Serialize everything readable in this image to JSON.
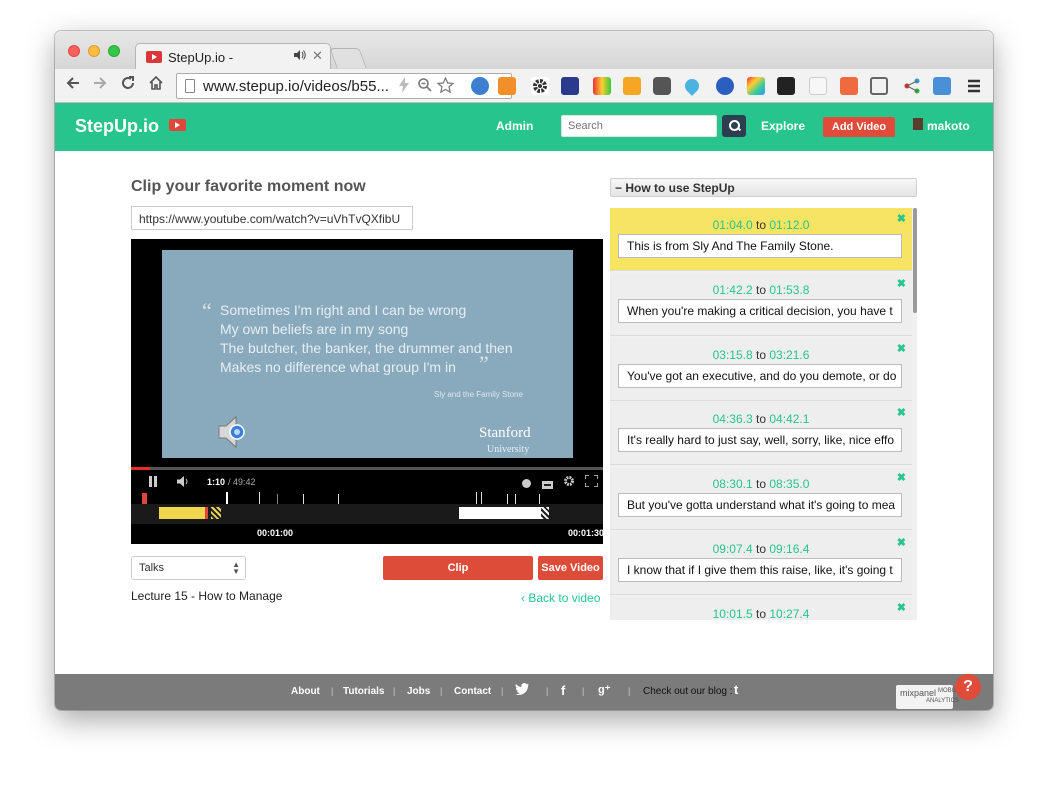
{
  "browser": {
    "tab_title": "StepUp.io -",
    "tab_audio_icon": "speaker-icon",
    "tab_close": "✕",
    "url": "www.stepup.io/videos/b55...",
    "nav": [
      "back-icon",
      "forward-icon",
      "reload-icon",
      "home-icon"
    ]
  },
  "header": {
    "logo": "StepUp.io",
    "admin": "Admin",
    "search_placeholder": "Search",
    "explore": "Explore",
    "add_video": "Add Video",
    "username": "makoto",
    "brand_color": "#27c58d",
    "accent_color": "#dd4b39"
  },
  "main": {
    "title": "Clip your favorite moment now",
    "video_url": "https://www.youtube.com/watch?v=uVhTvQXfibU",
    "slide": {
      "quote_open": "“",
      "quote_close": "”",
      "lines": [
        "Sometimes I'm right and I can be wrong",
        "My own beliefs are in my song",
        "The butcher, the banker, the drummer and then",
        "Makes no difference what group I'm in"
      ],
      "attribution": "Sly and the Family Stone",
      "logo_line1": "Stanford",
      "logo_line2": "University"
    },
    "player": {
      "current_time": "1:10",
      "duration": "/ 49:42",
      "progress_fraction": 0.0235,
      "timeline_labels": [
        "00:01:00",
        "00:01:30"
      ]
    },
    "category": "Talks",
    "clip_button": "Clip",
    "save_button": "Save Video",
    "lecture": "Lecture 15 - How to Manage",
    "back_link": "Back to video"
  },
  "sidebar": {
    "howto": "How to use StepUp",
    "howto_toggle": "−",
    "connector": "to",
    "clips": [
      {
        "start": "01:04.0",
        "end": "01:12.0",
        "note": "This is from Sly And The Family Stone.",
        "active": true
      },
      {
        "start": "01:42.2",
        "end": "01:53.8",
        "note": "When you're making a critical decision, you have t"
      },
      {
        "start": "03:15.8",
        "end": "03:21.6",
        "note": "You've got an executive, and do you demote, or do"
      },
      {
        "start": "04:36.3",
        "end": "04:42.1",
        "note": "It's really hard to just say, well, sorry, like, nice effo"
      },
      {
        "start": "08:30.1",
        "end": "08:35.0",
        "note": "But you've gotta understand what it's going to mea"
      },
      {
        "start": "09:07.4",
        "end": "09:16.4",
        "note": "I know that if I give them this raise, like, it's going t"
      },
      {
        "start": "10:01.5",
        "end": "10:27.4",
        "note": ""
      }
    ],
    "remove_icon": "✖"
  },
  "footer": {
    "links": [
      "About",
      "Tutorials",
      "Jobs",
      "Contact"
    ],
    "social": [
      "twitter-icon",
      "facebook-icon",
      "google-plus-icon"
    ],
    "blog": "Check out our blog :",
    "mixpanel_1": "mixpanel",
    "mixpanel_2": "MOBILE",
    "mixpanel_3": "ANALYTICS",
    "help": "?"
  }
}
